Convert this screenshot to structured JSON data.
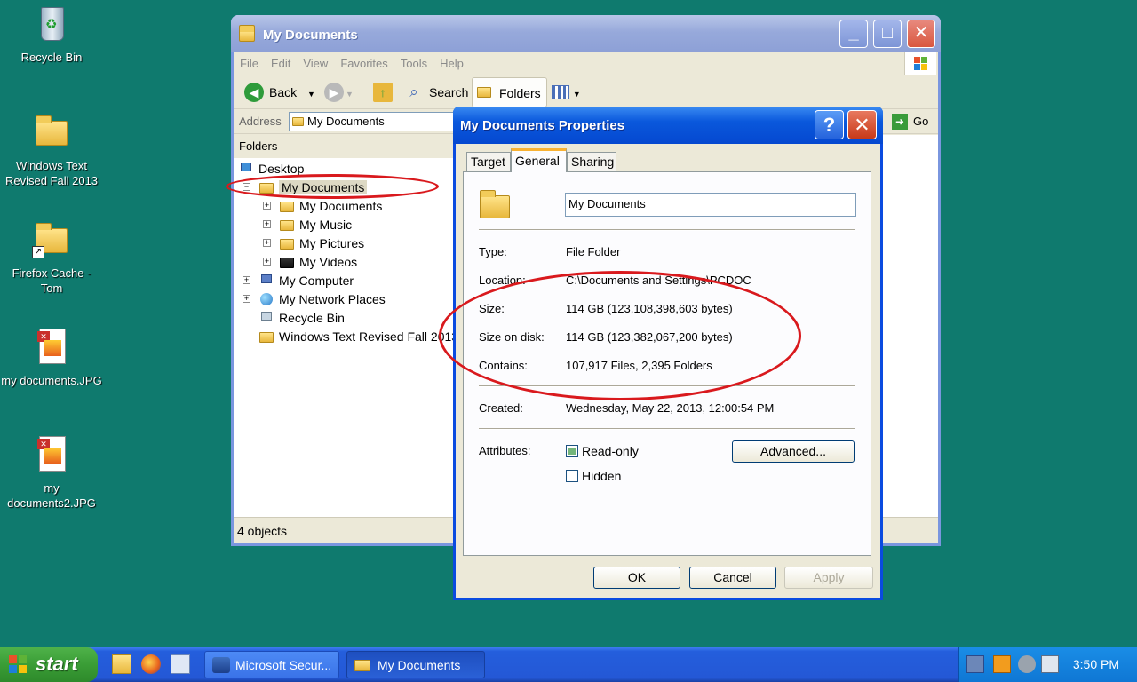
{
  "desktop": {
    "icons": [
      {
        "label": "Recycle Bin",
        "icon": "recycle-bin-icon"
      },
      {
        "label": "Windows Text Revised Fall 2013",
        "icon": "folder-icon"
      },
      {
        "label": "Firefox Cache - Tom",
        "icon": "folder-shortcut-icon"
      },
      {
        "label": "my documents.JPG",
        "icon": "jpg-file-icon"
      },
      {
        "label": "my documents2.JPG",
        "icon": "jpg-file-icon"
      }
    ]
  },
  "explorer": {
    "title": "My Documents",
    "menu": [
      "File",
      "Edit",
      "View",
      "Favorites",
      "Tools",
      "Help"
    ],
    "toolbar": {
      "back": "Back",
      "search": "Search",
      "folders": "Folders"
    },
    "address": {
      "label": "Address",
      "value": "My Documents",
      "go": "Go"
    },
    "folders_header": "Folders",
    "tree": [
      {
        "label": "Desktop"
      },
      {
        "label": "My Documents"
      },
      {
        "label": "My Documents"
      },
      {
        "label": "My Music"
      },
      {
        "label": "My Pictures"
      },
      {
        "label": "My Videos"
      },
      {
        "label": "My Computer"
      },
      {
        "label": "My Network Places"
      },
      {
        "label": "Recycle Bin"
      },
      {
        "label": "Windows Text Revised Fall 2013"
      }
    ],
    "status": "4 objects"
  },
  "dialog": {
    "title": "My Documents Properties",
    "help_btn": "?",
    "tabs": [
      "Target",
      "General",
      "Sharing"
    ],
    "active_tab": "General",
    "name_value": "My Documents",
    "props": {
      "type_label": "Type:",
      "type_value": "File Folder",
      "location_label": "Location:",
      "location_value": "C:\\Documents and Settings\\PCDOC",
      "size_label": "Size:",
      "size_value": "114 GB (123,108,398,603 bytes)",
      "disk_label": "Size on disk:",
      "disk_value": "114 GB (123,382,067,200 bytes)",
      "contains_label": "Contains:",
      "contains_value": "107,917 Files, 2,395 Folders",
      "created_label": "Created:",
      "created_value": "Wednesday, May 22, 2013, 12:00:54 PM",
      "attributes_label": "Attributes:"
    },
    "readonly": {
      "label": "Read-only",
      "checked": "partial"
    },
    "hidden": {
      "label": "Hidden",
      "checked": false
    },
    "advanced": "Advanced...",
    "ok": "OK",
    "cancel": "Cancel",
    "apply": "Apply"
  },
  "taskbar": {
    "start": "start",
    "tasks": [
      "Microsoft Secur...",
      "My Documents"
    ],
    "clock": "3:50 PM"
  },
  "colors": {
    "desktop": "#0f7a6e",
    "annotation": "#d9191d",
    "dialog_title": "#0548d0"
  }
}
